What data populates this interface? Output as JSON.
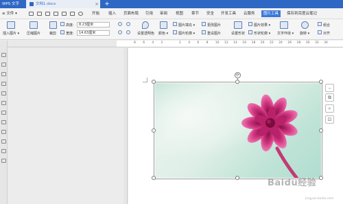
{
  "titlebar": {
    "app_label": "WPS 文字",
    "doc_tab": "文档1.docx",
    "add_tab": "+"
  },
  "menubar": {
    "file": "≡ 文件 ▾",
    "items": [
      "开始",
      "插入",
      "页面布局",
      "引用",
      "审阅",
      "视图",
      "章节",
      "安全",
      "开发工具",
      "云服务",
      "图片工具",
      "保存到百度云笔记"
    ],
    "active": "图片工具"
  },
  "ribbon": {
    "insert_picture": "插入图片 ▾",
    "compress": "压缩图片",
    "crop": "裁剪",
    "height_label": "高度:",
    "height_value": "8.23厘米",
    "width_label": "宽度:",
    "width_value": "14.63厘米",
    "set_transparent": "设置透明色",
    "color": "颜色 ▾",
    "fill": "图片填充 ▾",
    "outline": "图片轮廓 ▾",
    "change": "更改图片",
    "reset": "重设图片",
    "set_shape": "设置形状",
    "effects": "图片效果 ▾",
    "shape_outline": "形状轮廓 ▾",
    "text_wrap": "文字环绕 ▾",
    "rotate": "旋转 ▾",
    "combine": "组合",
    "align": "对齐"
  },
  "ruler": {
    "numbers": [
      "8",
      "6",
      "4",
      "2",
      "",
      "2",
      "4",
      "6",
      "8",
      "10",
      "12",
      "14",
      "16",
      "18",
      "20",
      "22",
      "24",
      "26",
      "28",
      "30",
      "32",
      "34"
    ]
  },
  "image": {
    "subject": "pink flower on green background",
    "accent": "#d0357f"
  },
  "float_tools": {
    "minus": "–",
    "layout": "⧉",
    "zoom": "⌕",
    "crop": "⊡"
  },
  "watermark": {
    "text": "Baidu经验",
    "sub": "jingyan.baidu.com"
  }
}
